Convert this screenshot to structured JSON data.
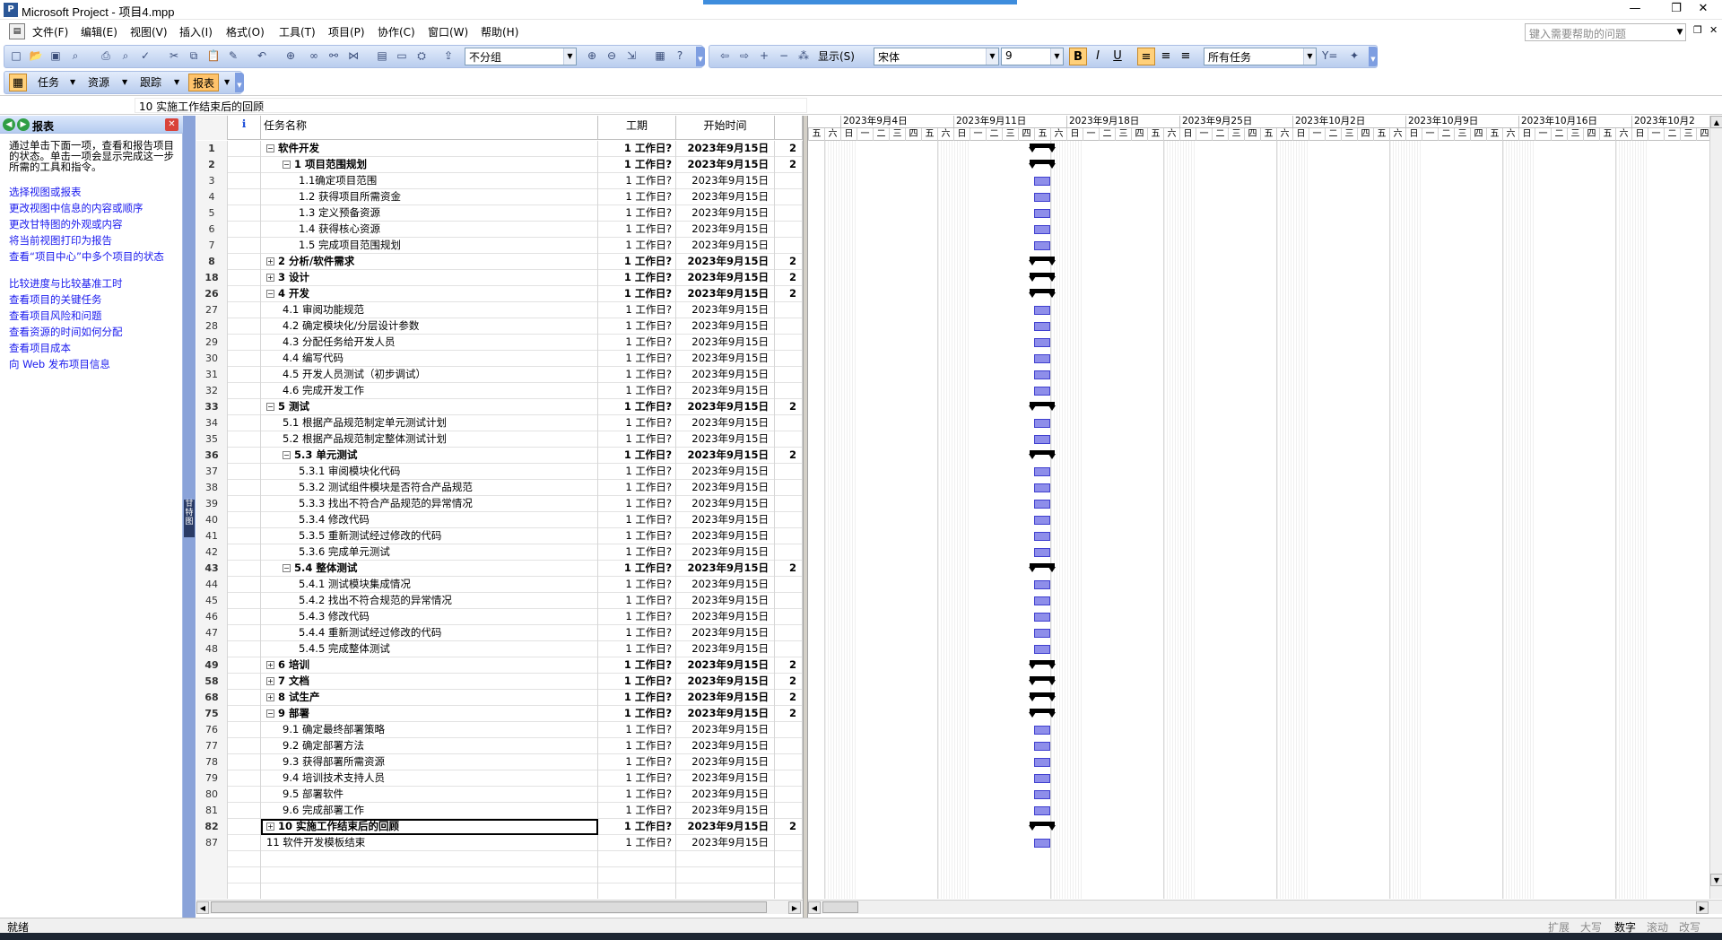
{
  "window": {
    "title": "Microsoft Project - 项目4.mpp",
    "minimize": "—",
    "maximize": "❐",
    "close": "✕"
  },
  "menu": {
    "items": [
      "文件(F)",
      "编辑(E)",
      "视图(V)",
      "插入(I)",
      "格式(O)",
      "工具(T)",
      "项目(P)",
      "协作(C)",
      "窗口(W)",
      "帮助(H)"
    ],
    "help_placeholder": "键入需要帮助的问题"
  },
  "toolbar": {
    "group_combo": "不分组",
    "show_label": "显示(S)",
    "font_combo": "宋体",
    "size_combo": "9",
    "bold": "B",
    "italic": "I",
    "underline": "U",
    "filter_combo": "所有任务",
    "guide": {
      "tasks": "任务",
      "resources": "资源",
      "track": "跟踪",
      "report": "报表"
    }
  },
  "entry_bar": {
    "value": "10  实施工作结束后的回顾"
  },
  "side_pane": {
    "title": "报表",
    "intro": "通过单击下面一项，查看和报告项目的状态。单击一项会显示完成这一步所需的工具和指令。",
    "links": [
      "选择视图或报表",
      "更改视图中信息的内容或顺序",
      "更改甘特图的外观或内容",
      "将当前视图打印为报告",
      "查看“项目中心”中多个项目的状态",
      "比较进度与比较基准工时",
      "查看项目的关键任务",
      "查看项目风险和问题",
      "查看资源的时间如何分配",
      "查看项目成本",
      "向 Web 发布项目信息"
    ]
  },
  "view_bar_label": "甘特图",
  "table": {
    "headers": {
      "indicator": "ℹ",
      "name": "任务名称",
      "duration": "工期",
      "start": "开始时间"
    },
    "rows": [
      {
        "id": "1",
        "name": "软件开发",
        "level": 0,
        "summary": true,
        "toggle": "−",
        "dur": "1 工作日?",
        "start": "2023年9月15日",
        "fin": "2"
      },
      {
        "id": "2",
        "name": "1  项目范围规划",
        "level": 1,
        "summary": true,
        "toggle": "−",
        "dur": "1 工作日?",
        "start": "2023年9月15日",
        "fin": "2"
      },
      {
        "id": "3",
        "name": "1.1确定项目范围",
        "level": 2,
        "summary": false,
        "toggle": "",
        "dur": "1 工作日?",
        "start": "2023年9月15日",
        "fin": ""
      },
      {
        "id": "4",
        "name": "1.2 获得项目所需资金",
        "level": 2,
        "summary": false,
        "toggle": "",
        "dur": "1 工作日?",
        "start": "2023年9月15日",
        "fin": ""
      },
      {
        "id": "5",
        "name": "1.3 定义预备资源",
        "level": 2,
        "summary": false,
        "toggle": "",
        "dur": "1 工作日?",
        "start": "2023年9月15日",
        "fin": ""
      },
      {
        "id": "6",
        "name": "1.4 获得核心资源",
        "level": 2,
        "summary": false,
        "toggle": "",
        "dur": "1 工作日?",
        "start": "2023年9月15日",
        "fin": ""
      },
      {
        "id": "7",
        "name": "1.5 完成项目范围规划",
        "level": 2,
        "summary": false,
        "toggle": "",
        "dur": "1 工作日?",
        "start": "2023年9月15日",
        "fin": ""
      },
      {
        "id": "8",
        "name": "2  分析/软件需求",
        "level": 0,
        "summary": true,
        "toggle": "+",
        "dur": "1 工作日?",
        "start": "2023年9月15日",
        "fin": "2"
      },
      {
        "id": "18",
        "name": "3  设计",
        "level": 0,
        "summary": true,
        "toggle": "+",
        "dur": "1 工作日?",
        "start": "2023年9月15日",
        "fin": "2"
      },
      {
        "id": "26",
        "name": "4  开发",
        "level": 0,
        "summary": true,
        "toggle": "−",
        "dur": "1 工作日?",
        "start": "2023年9月15日",
        "fin": "2"
      },
      {
        "id": "27",
        "name": "4.1  审阅功能规范",
        "level": 1,
        "summary": false,
        "toggle": "",
        "dur": "1 工作日?",
        "start": "2023年9月15日",
        "fin": ""
      },
      {
        "id": "28",
        "name": "4.2 确定模块化/分层设计参数",
        "level": 1,
        "summary": false,
        "toggle": "",
        "dur": "1 工作日?",
        "start": "2023年9月15日",
        "fin": ""
      },
      {
        "id": "29",
        "name": "4.3 分配任务给开发人员",
        "level": 1,
        "summary": false,
        "toggle": "",
        "dur": "1 工作日?",
        "start": "2023年9月15日",
        "fin": ""
      },
      {
        "id": "30",
        "name": "4.4 编写代码",
        "level": 1,
        "summary": false,
        "toggle": "",
        "dur": "1 工作日?",
        "start": "2023年9月15日",
        "fin": ""
      },
      {
        "id": "31",
        "name": "4.5 开发人员测试（初步调试）",
        "level": 1,
        "summary": false,
        "toggle": "",
        "dur": "1 工作日?",
        "start": "2023年9月15日",
        "fin": ""
      },
      {
        "id": "32",
        "name": "4.6 完成开发工作",
        "level": 1,
        "summary": false,
        "toggle": "",
        "dur": "1 工作日?",
        "start": "2023年9月15日",
        "fin": ""
      },
      {
        "id": "33",
        "name": "5  测试",
        "level": 0,
        "summary": true,
        "toggle": "−",
        "dur": "1 工作日?",
        "start": "2023年9月15日",
        "fin": "2"
      },
      {
        "id": "34",
        "name": "5.1 根据产品规范制定单元测试计划",
        "level": 1,
        "summary": false,
        "toggle": "",
        "dur": "1 工作日?",
        "start": "2023年9月15日",
        "fin": ""
      },
      {
        "id": "35",
        "name": "5.2 根据产品规范制定整体测试计划",
        "level": 1,
        "summary": false,
        "toggle": "",
        "dur": "1 工作日?",
        "start": "2023年9月15日",
        "fin": ""
      },
      {
        "id": "36",
        "name": "5.3  单元测试",
        "level": 1,
        "summary": true,
        "toggle": "−",
        "dur": "1 工作日?",
        "start": "2023年9月15日",
        "fin": "2"
      },
      {
        "id": "37",
        "name": "5.3.1  审阅模块化代码",
        "level": 2,
        "summary": false,
        "toggle": "",
        "dur": "1 工作日?",
        "start": "2023年9月15日",
        "fin": ""
      },
      {
        "id": "38",
        "name": "5.3.2 测试组件模块是否符合产品规范",
        "level": 2,
        "summary": false,
        "toggle": "",
        "dur": "1 工作日?",
        "start": "2023年9月15日",
        "fin": ""
      },
      {
        "id": "39",
        "name": "5.3.3 找出不符合产品规范的异常情况",
        "level": 2,
        "summary": false,
        "toggle": "",
        "dur": "1 工作日?",
        "start": "2023年9月15日",
        "fin": ""
      },
      {
        "id": "40",
        "name": "5.3.4 修改代码",
        "level": 2,
        "summary": false,
        "toggle": "",
        "dur": "1 工作日?",
        "start": "2023年9月15日",
        "fin": ""
      },
      {
        "id": "41",
        "name": "5.3.5 重新测试经过修改的代码",
        "level": 2,
        "summary": false,
        "toggle": "",
        "dur": "1 工作日?",
        "start": "2023年9月15日",
        "fin": ""
      },
      {
        "id": "42",
        "name": "5.3.6 完成单元测试",
        "level": 2,
        "summary": false,
        "toggle": "",
        "dur": "1 工作日?",
        "start": "2023年9月15日",
        "fin": ""
      },
      {
        "id": "43",
        "name": "5.4  整体测试",
        "level": 1,
        "summary": true,
        "toggle": "−",
        "dur": "1 工作日?",
        "start": "2023年9月15日",
        "fin": "2"
      },
      {
        "id": "44",
        "name": "5.4.1 测试模块集成情况",
        "level": 2,
        "summary": false,
        "toggle": "",
        "dur": "1 工作日?",
        "start": "2023年9月15日",
        "fin": ""
      },
      {
        "id": "45",
        "name": "5.4.2 找出不符合规范的异常情况",
        "level": 2,
        "summary": false,
        "toggle": "",
        "dur": "1 工作日?",
        "start": "2023年9月15日",
        "fin": ""
      },
      {
        "id": "46",
        "name": "5.4.3 修改代码",
        "level": 2,
        "summary": false,
        "toggle": "",
        "dur": "1 工作日?",
        "start": "2023年9月15日",
        "fin": ""
      },
      {
        "id": "47",
        "name": "5.4.4 重新测试经过修改的代码",
        "level": 2,
        "summary": false,
        "toggle": "",
        "dur": "1 工作日?",
        "start": "2023年9月15日",
        "fin": ""
      },
      {
        "id": "48",
        "name": "5.4.5 完成整体测试",
        "level": 2,
        "summary": false,
        "toggle": "",
        "dur": "1 工作日?",
        "start": "2023年9月15日",
        "fin": ""
      },
      {
        "id": "49",
        "name": "6  培训",
        "level": 0,
        "summary": true,
        "toggle": "+",
        "dur": "1 工作日?",
        "start": "2023年9月15日",
        "fin": "2"
      },
      {
        "id": "58",
        "name": "7  文档",
        "level": 0,
        "summary": true,
        "toggle": "+",
        "dur": "1 工作日?",
        "start": "2023年9月15日",
        "fin": "2"
      },
      {
        "id": "68",
        "name": "8  试生产",
        "level": 0,
        "summary": true,
        "toggle": "+",
        "dur": "1 工作日?",
        "start": "2023年9月15日",
        "fin": "2"
      },
      {
        "id": "75",
        "name": "9  部署",
        "level": 0,
        "summary": true,
        "toggle": "−",
        "dur": "1 工作日?",
        "start": "2023年9月15日",
        "fin": "2"
      },
      {
        "id": "76",
        "name": "9.1  确定最终部署策略",
        "level": 1,
        "summary": false,
        "toggle": "",
        "dur": "1 工作日?",
        "start": "2023年9月15日",
        "fin": ""
      },
      {
        "id": "77",
        "name": "9.2  确定部署方法",
        "level": 1,
        "summary": false,
        "toggle": "",
        "dur": "1 工作日?",
        "start": "2023年9月15日",
        "fin": ""
      },
      {
        "id": "78",
        "name": "9.3  获得部署所需资源",
        "level": 1,
        "summary": false,
        "toggle": "",
        "dur": "1 工作日?",
        "start": "2023年9月15日",
        "fin": ""
      },
      {
        "id": "79",
        "name": "9.4  培训技术支持人员",
        "level": 1,
        "summary": false,
        "toggle": "",
        "dur": "1 工作日?",
        "start": "2023年9月15日",
        "fin": ""
      },
      {
        "id": "80",
        "name": "9.5  部署软件",
        "level": 1,
        "summary": false,
        "toggle": "",
        "dur": "1 工作日?",
        "start": "2023年9月15日",
        "fin": ""
      },
      {
        "id": "81",
        "name": "9.6  完成部署工作",
        "level": 1,
        "summary": false,
        "toggle": "",
        "dur": "1 工作日?",
        "start": "2023年9月15日",
        "fin": ""
      },
      {
        "id": "82",
        "name": "10  实施工作结束后的回顾",
        "level": 0,
        "summary": true,
        "toggle": "+",
        "dur": "1 工作日?",
        "start": "2023年9月15日",
        "fin": "2",
        "selected": true
      },
      {
        "id": "87",
        "name": "11 软件开发模板结束",
        "level": 0,
        "summary": false,
        "toggle": "",
        "dur": "1 工作日?",
        "start": "2023年9月15日",
        "fin": ""
      }
    ]
  },
  "gantt": {
    "weeks": [
      "2023年9月4日",
      "2023年9月11日",
      "2023年9月18日",
      "2023年9月25日",
      "2023年10月2日",
      "2023年10月9日",
      "2023年10月16日",
      "2023年10月2"
    ],
    "days": [
      "日",
      "一",
      "二",
      "三",
      "四",
      "五",
      "六"
    ],
    "lead_days": [
      "五",
      "六"
    ],
    "bar_day_index": 12,
    "colors": {
      "task_bar": "#8e8eea",
      "task_border": "#3f3fcf",
      "summary_bar": "#000000"
    }
  },
  "statusbar": {
    "ready": "就绪",
    "ext": "扩展",
    "caps": "大写",
    "num": "数字",
    "scroll": "滚动",
    "ovr": "改写"
  }
}
